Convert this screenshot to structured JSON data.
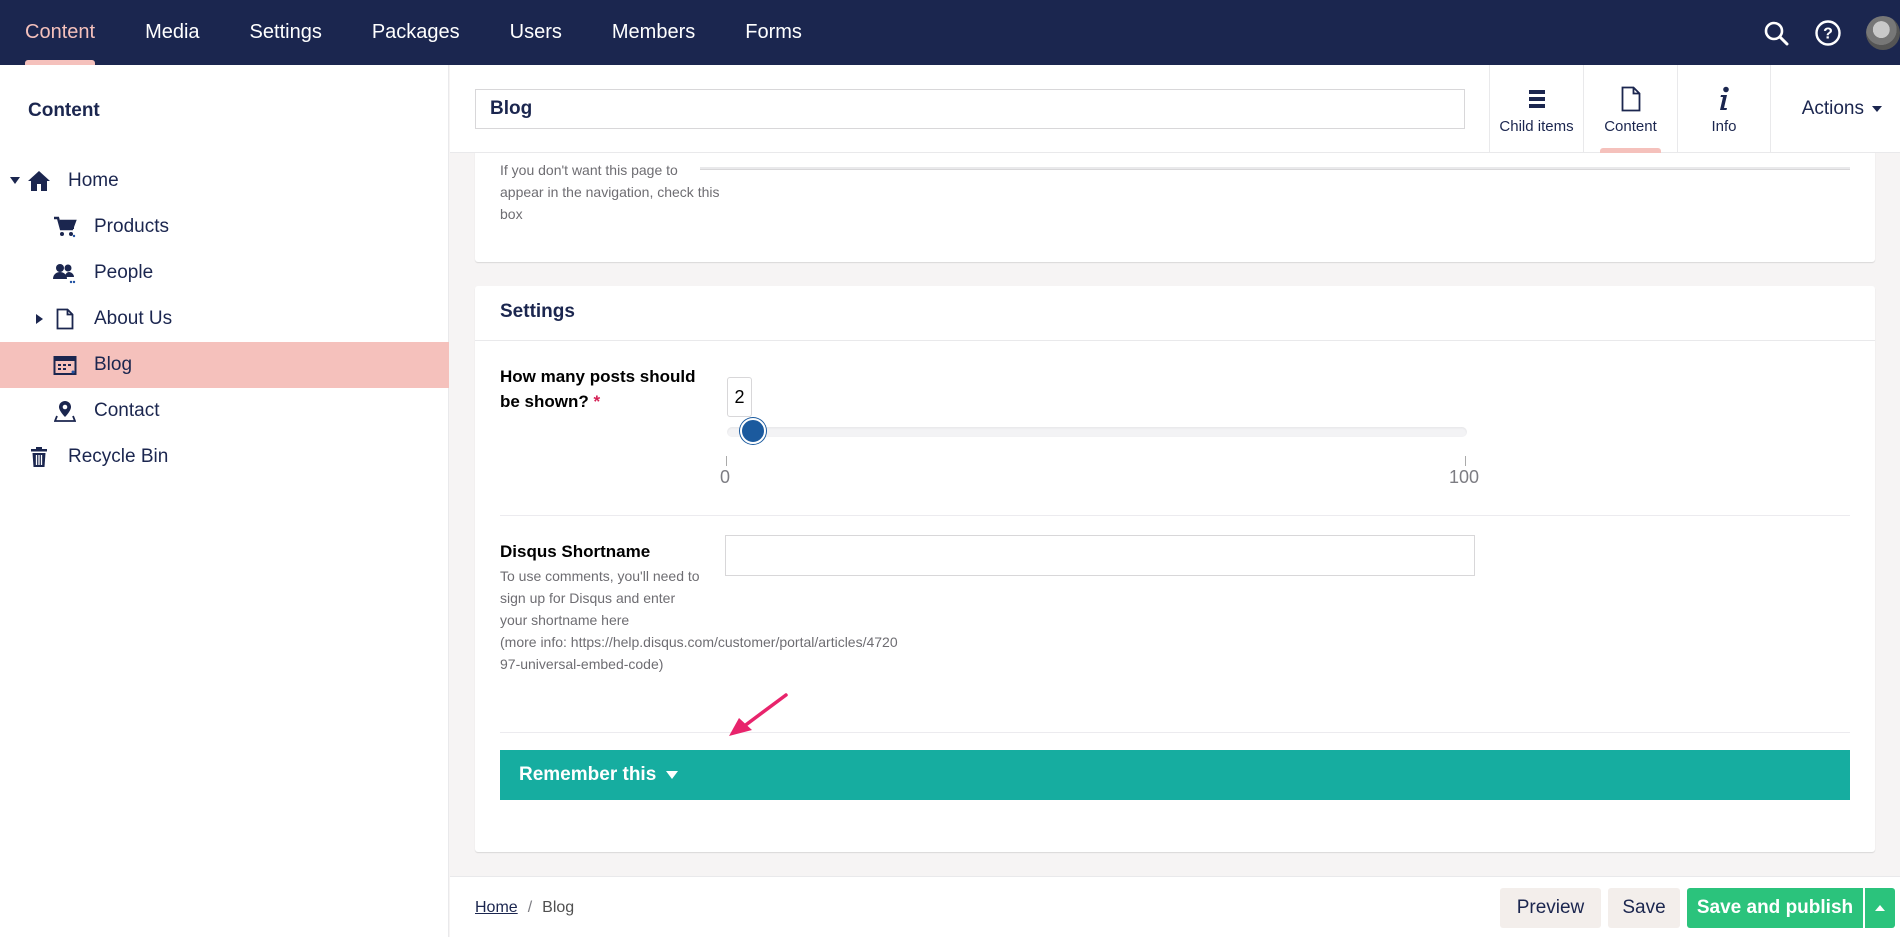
{
  "topnav": {
    "items": [
      {
        "label": "Content",
        "active": true
      },
      {
        "label": "Media"
      },
      {
        "label": "Settings"
      },
      {
        "label": "Packages"
      },
      {
        "label": "Users"
      },
      {
        "label": "Members"
      },
      {
        "label": "Forms"
      }
    ],
    "icons": [
      "search-icon",
      "help-icon",
      "user-avatar"
    ]
  },
  "sidebar": {
    "title": "Content",
    "tree": [
      {
        "label": "Home",
        "icon": "home-icon",
        "expanded": true
      },
      {
        "label": "Products",
        "icon": "shopping-cart-icon"
      },
      {
        "label": "People",
        "icon": "people-icon"
      },
      {
        "label": "About Us",
        "icon": "document-icon",
        "has_children": true
      },
      {
        "label": "Blog",
        "icon": "calendar-icon",
        "selected": true
      },
      {
        "label": "Contact",
        "icon": "map-pin-icon"
      },
      {
        "label": "Recycle Bin",
        "icon": "trash-icon"
      }
    ]
  },
  "editor": {
    "name_value": "Blog",
    "apps": [
      {
        "label": "Child items",
        "icon": "list-icon"
      },
      {
        "label": "Content",
        "icon": "document-icon",
        "active": true
      },
      {
        "label": "Info",
        "icon": "info-icon"
      }
    ],
    "actions_label": "Actions",
    "nav_hint": "If you don't want this page to appear in the navigation, check this box",
    "settings": {
      "title": "Settings",
      "posts_label": "How many posts should be shown?",
      "posts_required_mark": "*",
      "slider": {
        "value": "2",
        "min": "0",
        "max": "100"
      },
      "disqus_label": "Disqus Shortname",
      "disqus_value": "",
      "disqus_description": "To use comments, you'll need to sign up for Disqus and enter your shortname here (more info: https://help.disqus.com/customer/portal/articles/472097-universal-embed-code)",
      "remember_label": "Remember this"
    }
  },
  "footer": {
    "breadcrumb": {
      "home": "Home",
      "separator": "/",
      "current": "Blog"
    },
    "preview_label": "Preview",
    "save_label": "Save",
    "publish_label": "Save and publish"
  },
  "colors": {
    "topbar": "#1b264f",
    "accent_pink": "#f5c1bc",
    "teal": "#16ada0",
    "publish_green": "#2bc37c",
    "slider_blue": "#1b5a9e",
    "annotation_arrow": "#e8246c"
  }
}
